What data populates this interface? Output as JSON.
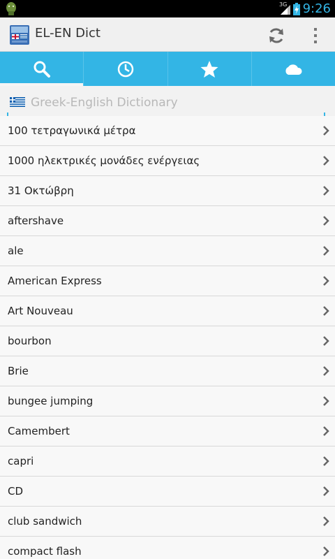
{
  "status": {
    "network": "3G",
    "time": "9:26"
  },
  "app": {
    "title": "EL-EN Dict"
  },
  "tabs": [
    {
      "icon": "search-icon",
      "active": true
    },
    {
      "icon": "history-icon",
      "active": false
    },
    {
      "icon": "star-icon",
      "active": false
    },
    {
      "icon": "cloud-icon",
      "active": false
    }
  ],
  "search": {
    "placeholder": "Greek-English Dictionary",
    "value": ""
  },
  "colors": {
    "accent": "#33b5e5",
    "text": "#222222"
  },
  "list": {
    "items": [
      "100 τετραγωνικά μέτρα",
      "1000 ηλεκτρικές μονάδες ενέργειας",
      "31 Οκτώβρη",
      "aftershave",
      "ale",
      "American Express",
      "Art Nouveau",
      "bourbon",
      "Brie",
      "bungee jumping",
      "Camembert",
      "capri",
      "CD",
      "club sandwich",
      "compact flash"
    ]
  }
}
